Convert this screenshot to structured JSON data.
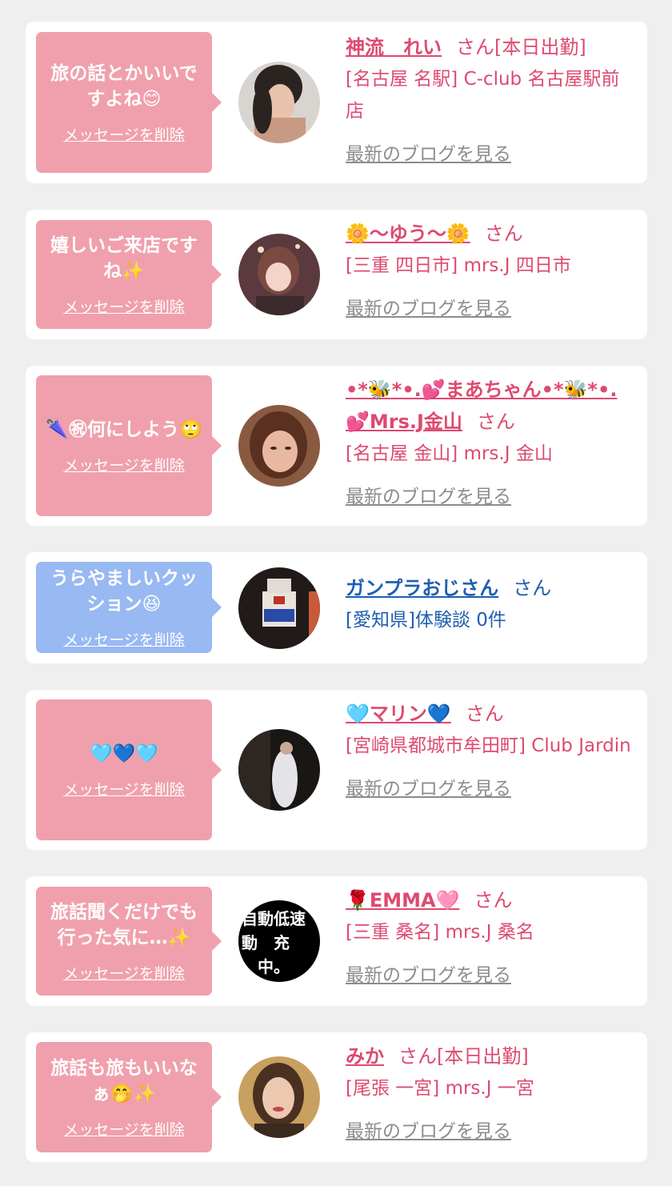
{
  "items": [
    {
      "message": "旅の話とかいいですよね😊",
      "delete_label": "メッセージを削除",
      "name": "神流　れい",
      "san": "さん[本日出勤]",
      "location": "[名古屋 名駅] C-club 名古屋駅前店",
      "blog_label": "最新のブログを見る",
      "bubble_color": "#f0a0ac"
    },
    {
      "message": "嬉しいご来店ですね✨",
      "delete_label": "メッセージを削除",
      "name": "🌼〜ゆう〜🌼",
      "san": "さん",
      "location": "[三重 四日市] mrs.J 四日市",
      "blog_label": "最新のブログを見る",
      "bubble_color": "#f0a0ac"
    },
    {
      "message": "🌂㊗何にしよう🙄",
      "delete_label": "メッセージを削除",
      "name": "•*🐝*•.💕まあちゃん•*🐝*•.💕Mrs.J金山",
      "san": "さん",
      "location": "[名古屋 金山] mrs.J 金山",
      "blog_label": "最新のブログを見る",
      "bubble_color": "#f0a0ac"
    },
    {
      "message": "うらやましいクッション😆",
      "delete_label": "メッセージを削除",
      "name": "ガンプラおじさん",
      "san": "さん",
      "location": "[愛知県]体験談 0件",
      "blog_label": "",
      "bubble_color": "#98b9f2"
    },
    {
      "message": "🩵💙🩵",
      "delete_label": "メッセージを削除",
      "name": "🩵マリン💙",
      "san": "さん",
      "location": "[宮崎県都城市牟田町] Club Jardin",
      "blog_label": "最新のブログを見る",
      "bubble_color": "#f0a0ac"
    },
    {
      "message": "旅話聞くだけでも行った気に…✨",
      "delete_label": "メッセージを削除",
      "name": "🌹EMMA🩷",
      "san": "さん",
      "location": "[三重 桑名] mrs.J 桑名",
      "blog_label": "最新のブログを見る",
      "bubble_color": "#f0a0ac",
      "avatar_text": "自動低速\n動　充\n　中。"
    },
    {
      "message": "旅話も旅もいいなぁ🤭✨",
      "delete_label": "メッセージを削除",
      "name": "みか",
      "san": "さん[本日出勤]",
      "location": "[尾張 一宮] mrs.J 一宮",
      "blog_label": "最新のブログを見る",
      "bubble_color": "#f0a0ac"
    }
  ]
}
